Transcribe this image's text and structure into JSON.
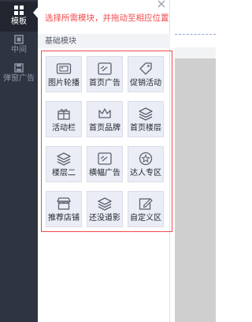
{
  "nav": {
    "items": [
      {
        "label": "模板",
        "icon": "grid-icon",
        "active": true
      },
      {
        "label": "中间",
        "icon": "square-icon",
        "active": false
      },
      {
        "label": "弹窗广告",
        "icon": "save-icon",
        "active": false
      }
    ]
  },
  "panel": {
    "hint": "选择所需模块，并拖动至相应位置",
    "section_title": "基础模块",
    "modules": [
      {
        "label": "图片轮播",
        "icon": "image-carousel-icon"
      },
      {
        "label": "首页广告",
        "icon": "ad-image-icon"
      },
      {
        "label": "促销活动",
        "icon": "price-tag-icon"
      },
      {
        "label": "活动栏",
        "icon": "gift-icon"
      },
      {
        "label": "首页品牌",
        "icon": "crown-icon"
      },
      {
        "label": "首页楼层",
        "icon": "layers-icon"
      },
      {
        "label": "楼层二",
        "icon": "layers-icon"
      },
      {
        "label": "横幅广告",
        "icon": "ad-image-icon"
      },
      {
        "label": "达人专区",
        "icon": "star-badge-icon"
      },
      {
        "label": "推荐店铺",
        "icon": "store-icon"
      },
      {
        "label": "还没道影",
        "icon": "layers-icon"
      },
      {
        "label": "自定义区",
        "icon": "edit-icon"
      }
    ]
  },
  "colors": {
    "nav_bg": "#2f3441",
    "nav_active_bg": "#222630",
    "hint": "#f0494c",
    "module_bg": "#eaedf5",
    "selection_border": "#ee4b4b",
    "icon_stroke": "#5b6170"
  }
}
